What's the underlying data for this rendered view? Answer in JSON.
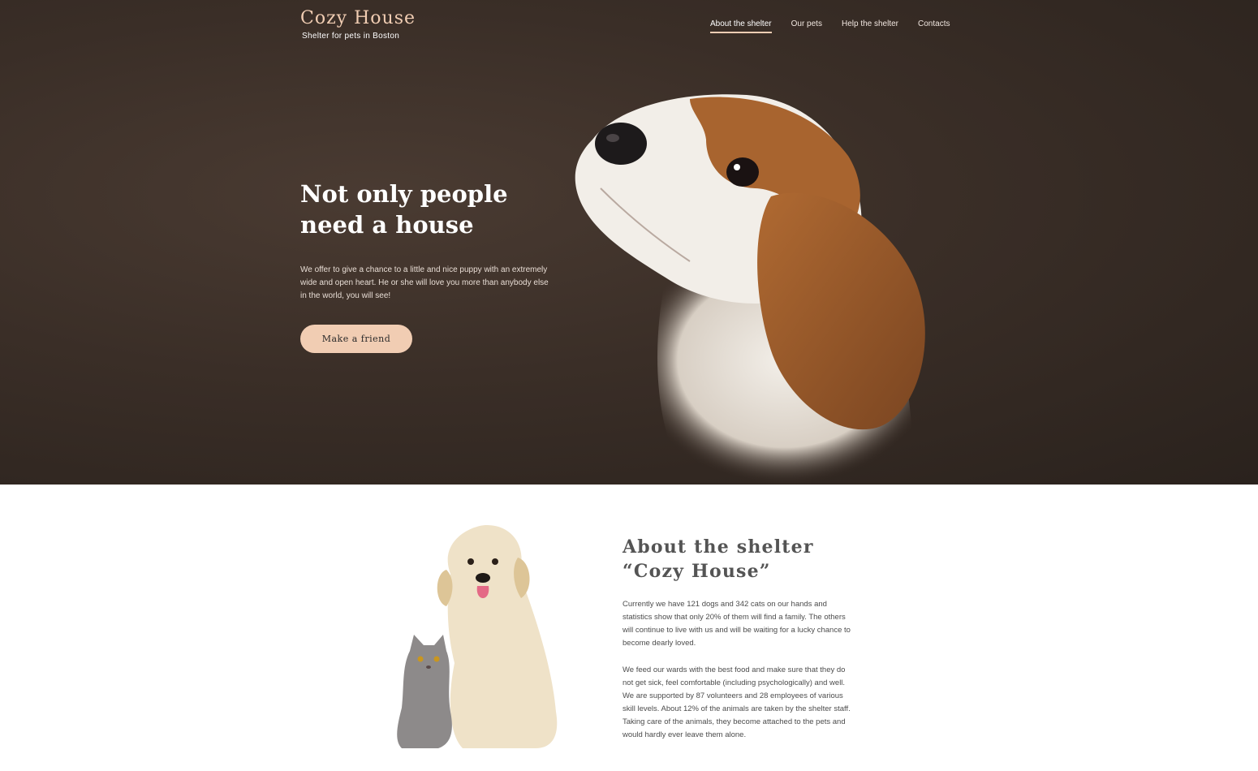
{
  "header": {
    "logo_title": "Cozy House",
    "logo_subtitle": "Shelter for pets in Boston",
    "nav": [
      {
        "label": "About the shelter",
        "active": true
      },
      {
        "label": "Our pets",
        "active": false
      },
      {
        "label": "Help the shelter",
        "active": false
      },
      {
        "label": "Contacts",
        "active": false
      }
    ]
  },
  "hero": {
    "title_line1": "Not only people",
    "title_line2": "need a house",
    "text": "We offer to give a chance to a little and nice puppy with an extremely wide and open heart. He or she will love you more than anybody else in the world, you will see!",
    "button_label": "Make a friend",
    "image": "beagle-puppy-photo"
  },
  "about": {
    "title_line1": "About the shelter",
    "title_line2": "“Cozy House”",
    "paragraph1": "Currently we have 121 dogs and 342 cats on our hands and statistics show that only 20% of them will find a family. The others will continue to live with us and will be waiting for a lucky chance to become dearly loved.",
    "paragraph2": "We feed our wards with the best food and make sure that they do not get sick, feel comfortable (including psychologically) and well. We are supported by 87 volunteers and 28 employees of various skill levels. About 12% of the animals are taken by the shelter staff. Taking care of the animals, they become attached to the pets and would hardly ever leave them alone.",
    "image": "dog-and-cat-photo"
  },
  "colors": {
    "accent": "#f1cdb3",
    "hero_bg": "#3a2e27",
    "heading_gray": "#545454"
  }
}
